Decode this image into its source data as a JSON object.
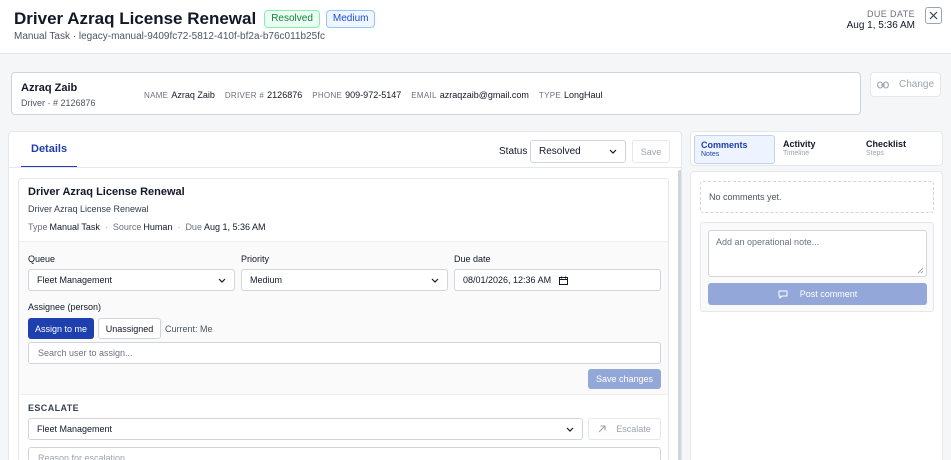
{
  "header": {
    "title": "Driver Azraq License Renewal",
    "badges": {
      "status": "Resolved",
      "priority": "Medium"
    },
    "subtitle": "Manual Task · legacy-manual-9409fc72-5812-410f-bf2a-b76c011b25fc",
    "due_label": "DUE DATE",
    "due_value": "Aug 1, 5:36 AM",
    "close_icon": "close-icon"
  },
  "driver": {
    "name": "Azraq Zaib",
    "sub": "Driver · # 2126876",
    "fields": {
      "name_label": "NAME",
      "name_value": "Azraq Zaib",
      "driver_label": "DRIVER #",
      "driver_value": "2126876",
      "phone_label": "PHONE",
      "phone_value": "909-972-5147",
      "email_label": "EMAIL",
      "email_value": "azraqzaib@gmail.com",
      "type_label": "TYPE",
      "type_value": "LongHaul"
    },
    "change_label": "Change",
    "change_icon": "link-icon"
  },
  "details": {
    "tab_label": "Details",
    "status_label": "Status",
    "status_value": "Resolved",
    "save_label": "Save",
    "card": {
      "title": "Driver Azraq License Renewal",
      "description": "Driver Azraq License Renewal",
      "meta": {
        "type_label": "Type",
        "type_value": "Manual Task",
        "source_label": "Source",
        "source_value": "Human",
        "due_label": "Due",
        "due_value": "Aug 1, 5:36 AM"
      }
    },
    "form": {
      "queue_label": "Queue",
      "queue_value": "Fleet Management",
      "priority_label": "Priority",
      "priority_value": "Medium",
      "due_label": "Due date",
      "due_value": "08/01/2026, 12:36 AM",
      "assignee_label": "Assignee (person)",
      "assign_me_label": "Assign to me",
      "unassigned_label": "Unassigned",
      "current_label": "Current: Me",
      "search_placeholder": "Search user to assign...",
      "save_changes_label": "Save changes"
    },
    "escalate": {
      "heading": "ESCALATE",
      "queue_value": "Fleet Management",
      "button_label": "Escalate",
      "reason_placeholder": "Reason for escalation"
    }
  },
  "side": {
    "tabs": [
      {
        "title": "Comments",
        "sub": "Notes"
      },
      {
        "title": "Activity",
        "sub": "Timeline"
      },
      {
        "title": "Checklist",
        "sub": "Steps"
      }
    ],
    "empty_text": "No comments yet.",
    "note_placeholder": "Add an operational note...",
    "post_label": "Post comment"
  },
  "colors": {
    "accent": "#1e40af",
    "resolved": "#15803d",
    "disabled_button": "#93a8d8"
  }
}
